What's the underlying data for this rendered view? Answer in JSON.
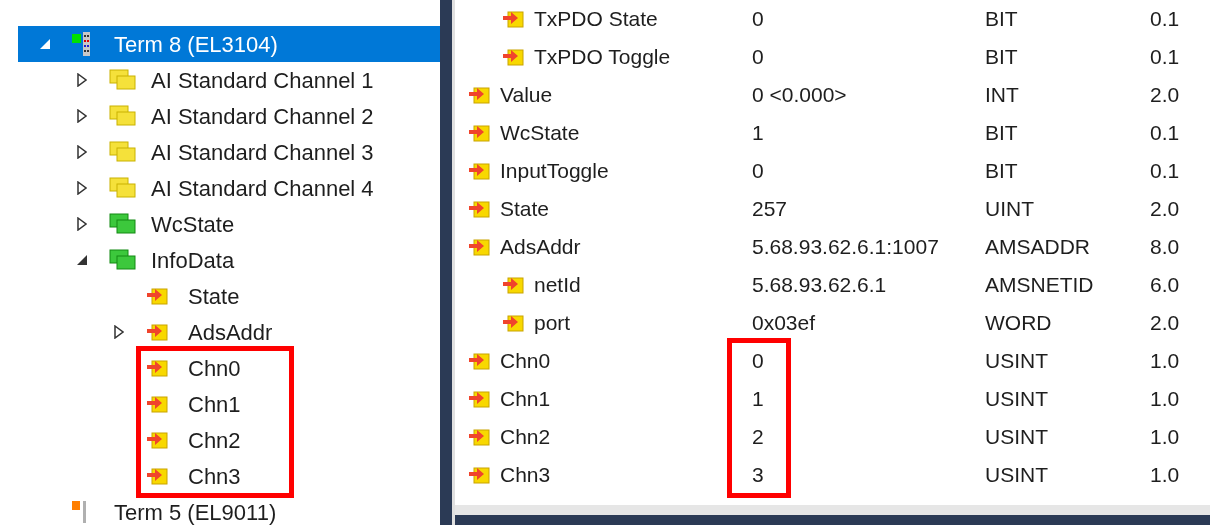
{
  "tree": [
    {
      "label": "Term 8 (EL3104)",
      "kind": "terminal",
      "selected": true,
      "expanded": true,
      "children": [
        {
          "label": "AI Standard Channel 1",
          "kind": "channel",
          "selected": false,
          "expanded": false
        },
        {
          "label": "AI Standard Channel 2",
          "kind": "channel",
          "selected": false,
          "expanded": false
        },
        {
          "label": "AI Standard Channel 3",
          "kind": "channel",
          "selected": false,
          "expanded": false
        },
        {
          "label": "AI Standard Channel 4",
          "kind": "channel",
          "selected": false,
          "expanded": false
        },
        {
          "label": "WcState",
          "kind": "group",
          "selected": false,
          "expanded": false
        },
        {
          "label": "InfoData",
          "kind": "group",
          "selected": false,
          "expanded": true,
          "children": [
            {
              "label": "State",
              "kind": "variable",
              "selected": false
            },
            {
              "label": "AdsAddr",
              "kind": "variable",
              "selected": false,
              "expanded": false
            },
            {
              "label": "Chn0",
              "kind": "variable",
              "selected": false,
              "highlighted": true
            },
            {
              "label": "Chn1",
              "kind": "variable",
              "selected": false,
              "highlighted": true
            },
            {
              "label": "Chn2",
              "kind": "variable",
              "selected": false,
              "highlighted": true
            },
            {
              "label": "Chn3",
              "kind": "variable",
              "selected": false,
              "highlighted": true
            }
          ]
        }
      ]
    },
    {
      "label": "Term 5 (EL9011)",
      "kind": "end_terminal",
      "selected": false
    }
  ],
  "variables": [
    {
      "children": [
        {
          "name": "TxPDO State",
          "value": "0",
          "type": "BIT",
          "size": "0.1"
        },
        {
          "name": "TxPDO Toggle",
          "value": "0",
          "type": "BIT",
          "size": "0.1"
        }
      ]
    },
    {
      "name": "Value",
      "value": "0 <0.000>",
      "type": "INT",
      "size": "2.0"
    },
    {
      "name": "WcState",
      "value": "1",
      "type": "BIT",
      "size": "0.1"
    },
    {
      "name": "InputToggle",
      "value": "0",
      "type": "BIT",
      "size": "0.1"
    },
    {
      "name": "State",
      "value": "257",
      "type": "UINT",
      "size": "2.0"
    },
    {
      "name": "AdsAddr",
      "value": "5.68.93.62.6.1:1007",
      "type": "AMSADDR",
      "size": "8.0",
      "children": [
        {
          "name": "netId",
          "value": "5.68.93.62.6.1",
          "type": "AMSNETID",
          "size": "6.0"
        },
        {
          "name": "port",
          "value": "0x03ef",
          "type": "WORD",
          "size": "2.0"
        }
      ]
    },
    {
      "name": "Chn0",
      "value": "0",
      "type": "USINT",
      "size": "1.0",
      "value_highlighted": true
    },
    {
      "name": "Chn1",
      "value": "1",
      "type": "USINT",
      "size": "1.0",
      "value_highlighted": true
    },
    {
      "name": "Chn2",
      "value": "2",
      "type": "USINT",
      "size": "1.0",
      "value_highlighted": true
    },
    {
      "name": "Chn3",
      "value": "3",
      "type": "USINT",
      "size": "1.0",
      "value_highlighted": true
    }
  ]
}
